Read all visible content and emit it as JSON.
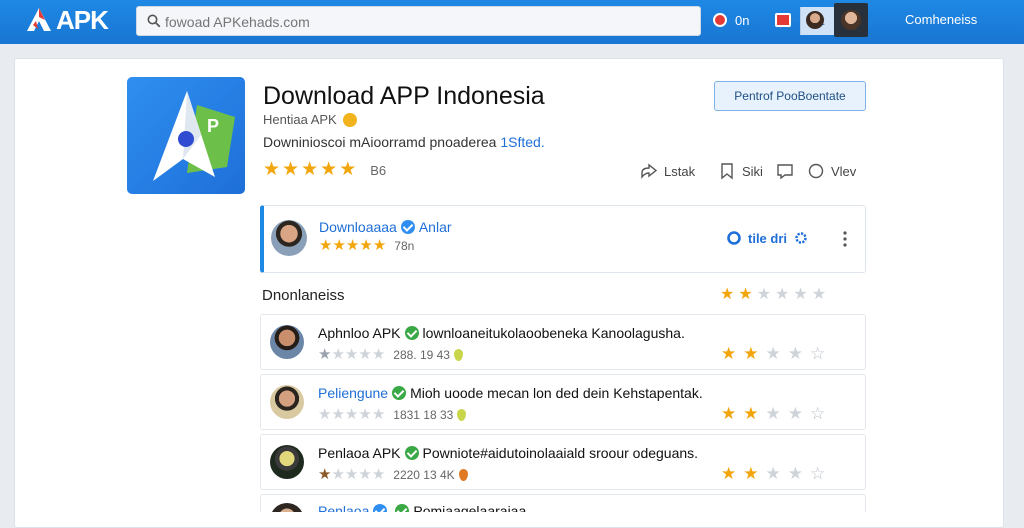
{
  "header": {
    "logo_text": "APK",
    "search_placeholder": "fowoad APKehads.com",
    "search_button": "t.t",
    "item1_label": "0n",
    "right_link": "Comheneiss"
  },
  "app": {
    "title": "Download APP Indonesia",
    "subtitle": "Hentiaa APK",
    "description": "Downinioscoi mAioorramd pnoaderea",
    "description_link": "1Sfted.",
    "rating_stars": 4.5,
    "rating_count": "B6",
    "primary_button": "Pentrof PooBoentate"
  },
  "actions": [
    {
      "label": "Lstak"
    },
    {
      "label": "Siki"
    },
    {
      "label": "Vlev"
    }
  ],
  "featured": {
    "name": "Downloaaaa",
    "author": "Anlar",
    "rating_stars": 5,
    "count": "78n",
    "tag": "tile dri"
  },
  "section": {
    "label": "Dnonlaneiss"
  },
  "reviews": [
    {
      "name": "Aphnloo APK",
      "name_color": "#111111",
      "text": "lownloaneitukolaoobeneka Kanoolagusha.",
      "rating": 1,
      "meta": "288. 19 43",
      "pin": "green",
      "right_rating": 2
    },
    {
      "name": "Peliengune",
      "name_color": "#1e6fd8",
      "text": "Mioh uoode mecan lon ded dein Kehstapentak.",
      "rating": 0,
      "meta": "1831 18 33",
      "pin": "green",
      "right_rating": 2
    },
    {
      "name": "Penlaoa APK",
      "name_color": "#111111",
      "text": "Powniote#aidutoinolaaiald sroour odeguans.",
      "rating": 1,
      "meta": "2220 13 4K",
      "pin": "orange",
      "right_rating": 2
    },
    {
      "name": "Penlaoa",
      "name_color": "#1e6fd8",
      "text": "Pomiaagelaaraiaa",
      "rating": 0,
      "meta": "",
      "pin": "",
      "right_rating": 0
    }
  ],
  "colors": {
    "topbar": "#1976d2",
    "accent": "#1e88e5",
    "star": "#f2a60c",
    "verified_blue": "#2f8ff0",
    "verified_green": "#3aa845"
  },
  "icons": [
    "apk-logo-icon",
    "search-icon",
    "bookmark-star-icon",
    "notification-icon",
    "flag-icon",
    "share-icon",
    "bookmark-icon",
    "comment-icon",
    "view-icon",
    "more-vert-icon",
    "verified-icon"
  ]
}
